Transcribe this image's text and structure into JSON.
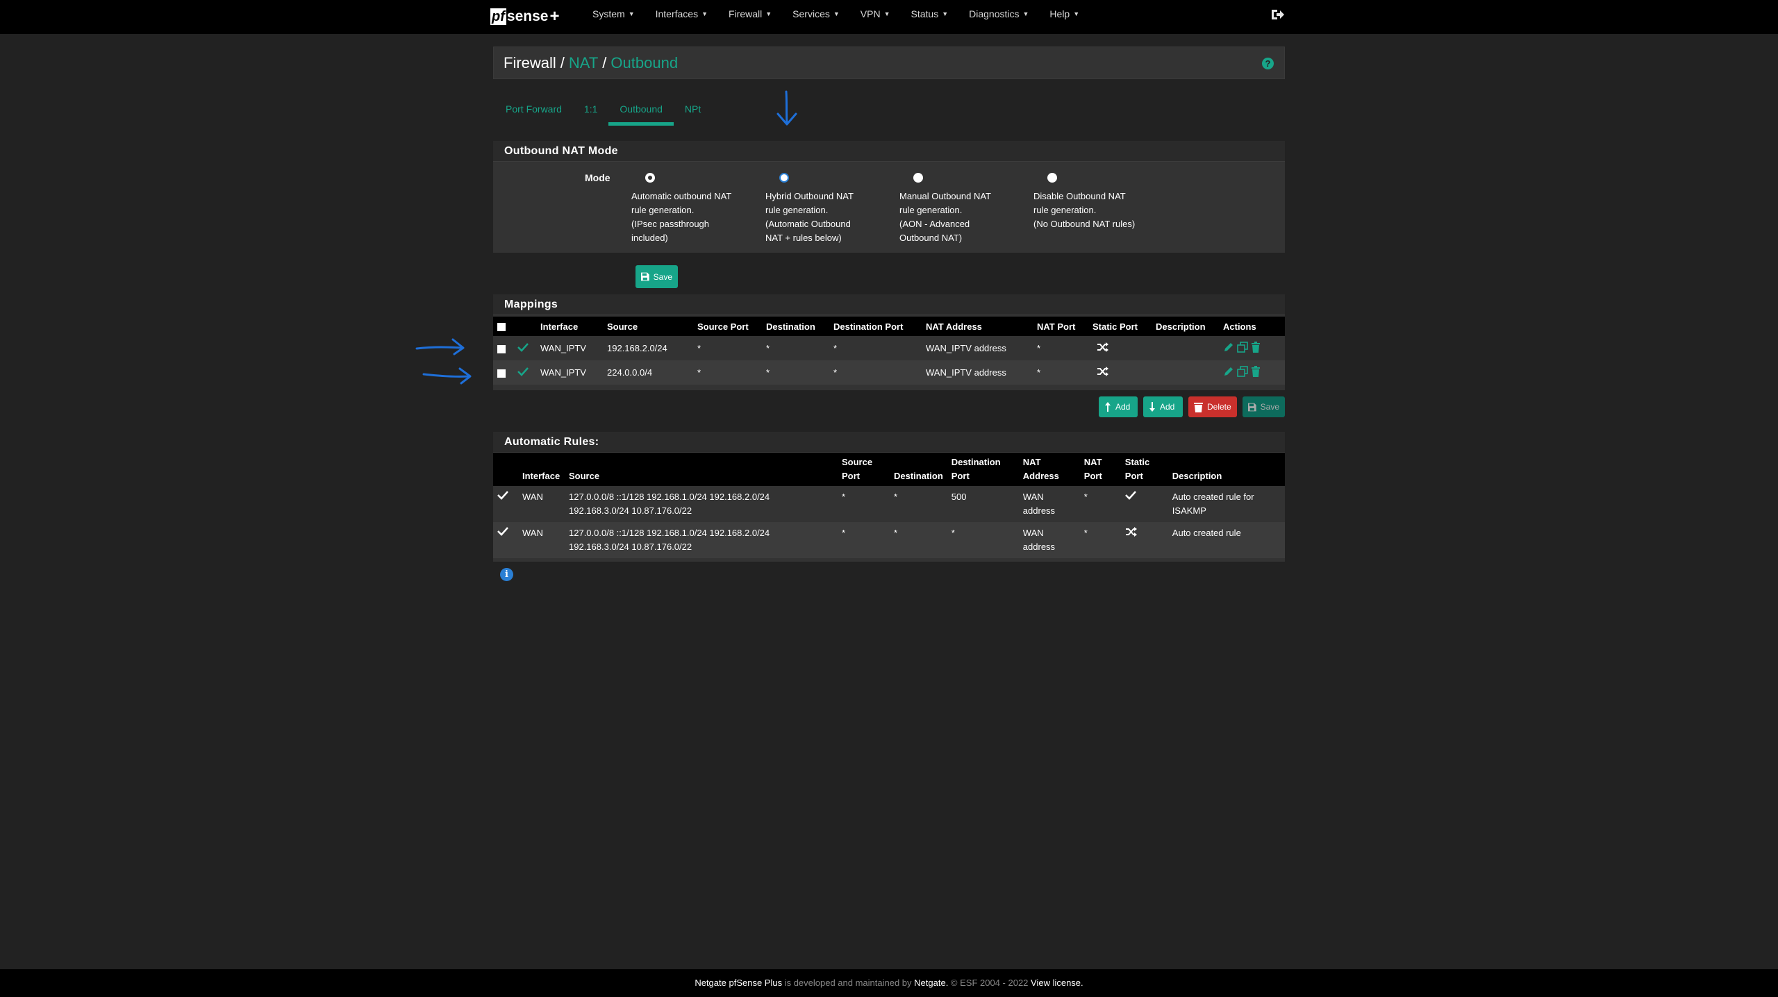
{
  "brand": {
    "logo_box": "pf",
    "logo_rest": "sense",
    "logo_plus": "+"
  },
  "nav": {
    "items": [
      {
        "label": "System"
      },
      {
        "label": "Interfaces"
      },
      {
        "label": "Firewall"
      },
      {
        "label": "Services"
      },
      {
        "label": "VPN"
      },
      {
        "label": "Status"
      },
      {
        "label": "Diagnostics"
      },
      {
        "label": "Help"
      }
    ]
  },
  "breadcrumb": {
    "root": "Firewall",
    "level2": "NAT",
    "level3": "Outbound",
    "sep": "/"
  },
  "tabs": [
    {
      "label": "Port Forward",
      "active": false
    },
    {
      "label": "1:1",
      "active": false
    },
    {
      "label": "Outbound",
      "active": true
    },
    {
      "label": "NPt",
      "active": false
    }
  ],
  "nat_mode": {
    "heading": "Outbound NAT Mode",
    "mode_label": "Mode",
    "selected": "automatic",
    "options": [
      {
        "lines": [
          "Automatic outbound NAT",
          "rule generation.",
          "(IPsec passthrough",
          "included)"
        ]
      },
      {
        "lines": [
          "Hybrid Outbound NAT",
          "rule generation.",
          "(Automatic Outbound",
          "NAT + rules below)"
        ]
      },
      {
        "lines": [
          "Manual Outbound NAT",
          "rule generation.",
          "(AON - Advanced",
          "Outbound NAT)"
        ]
      },
      {
        "lines": [
          "Disable Outbound NAT",
          "rule generation.",
          "(No Outbound NAT rules)"
        ]
      }
    ],
    "save_label": "Save"
  },
  "mappings": {
    "heading": "Mappings",
    "columns": [
      "Interface",
      "Source",
      "Source Port",
      "Destination",
      "Destination Port",
      "NAT Address",
      "NAT Port",
      "Static Port",
      "Description",
      "Actions"
    ],
    "rows": [
      {
        "interface": "WAN_IPTV",
        "source": "192.168.2.0/24",
        "source_port": "*",
        "destination": "*",
        "destination_port": "*",
        "nat_address": "WAN_IPTV address",
        "nat_port": "*",
        "description": ""
      },
      {
        "interface": "WAN_IPTV",
        "source": "224.0.0.0/4",
        "source_port": "*",
        "destination": "*",
        "destination_port": "*",
        "nat_address": "WAN_IPTV address",
        "nat_port": "*",
        "description": ""
      }
    ],
    "buttons": {
      "add_top": "Add",
      "add_bottom": "Add",
      "delete": "Delete",
      "save": "Save"
    }
  },
  "auto_rules": {
    "heading": "Automatic Rules:",
    "columns": {
      "interface": "Interface",
      "source": "Source",
      "source_port": [
        "Source",
        "Port"
      ],
      "destination": "Destination",
      "destination_port": [
        "Destination",
        "Port"
      ],
      "nat_address": [
        "NAT",
        "Address"
      ],
      "nat_port": [
        "NAT",
        "Port"
      ],
      "static_port": [
        "Static",
        "Port"
      ],
      "description": "Description"
    },
    "rows": [
      {
        "interface": "WAN",
        "source": [
          "127.0.0.0/8 ::1/128 192.168.1.0/24 192.168.2.0/24",
          "192.168.3.0/24 10.87.176.0/22"
        ],
        "source_port": "*",
        "destination": "*",
        "destination_port": "500",
        "nat_address": [
          "WAN",
          "address"
        ],
        "nat_port": "*",
        "static_port": "check",
        "description": [
          "Auto created rule for",
          "ISAKMP"
        ]
      },
      {
        "interface": "WAN",
        "source": [
          "127.0.0.0/8 ::1/128 192.168.1.0/24 192.168.2.0/24",
          "192.168.3.0/24 10.87.176.0/22"
        ],
        "source_port": "*",
        "destination": "*",
        "destination_port": "*",
        "nat_address": [
          "WAN",
          "address"
        ],
        "nat_port": "*",
        "static_port": "shuffle",
        "description": [
          "Auto created rule",
          ""
        ]
      }
    ]
  },
  "footer": {
    "product": "Netgate pfSense Plus",
    "middle": " is developed and maintained by ",
    "company": "Netgate.",
    "copyright": " © ESF 2004 - 2022 ",
    "license": "View license."
  },
  "colors": {
    "accent": "#17a589",
    "delete": "#c9302c",
    "annotation": "#1e6fd9",
    "info": "#2a7fd4"
  }
}
